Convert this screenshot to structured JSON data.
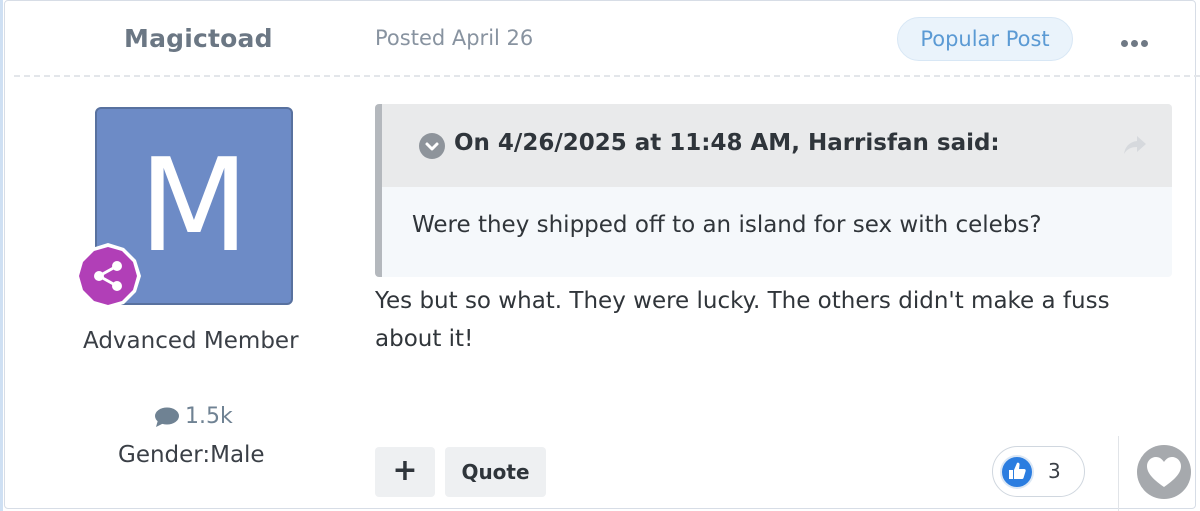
{
  "post": {
    "author": "Magictoad",
    "posted": "Posted April 26",
    "badge": "Popular Post",
    "avatar_letter": "M",
    "member_title": "Advanced Member",
    "post_count": "1.5k",
    "gender": "Gender:Male"
  },
  "quote": {
    "header": "On 4/26/2025 at 11:48 AM, Harrisfan said:",
    "text": "Were they shipped off to an island for sex with celebs?"
  },
  "body": {
    "text": "Yes but so what. They were lucky. The others didn't make a fuss about it!"
  },
  "actions": {
    "plus_label": "+",
    "quote_label": "Quote",
    "reaction_count": "3"
  },
  "colors": {
    "avatar_bg": "#6d8bc6",
    "badge_text": "#5b9ad4",
    "rank_badge": "#b13fb7",
    "like_blue": "#2b7de0"
  },
  "icons": [
    "more-icon",
    "rank-badge-icon",
    "comment-icon",
    "chevron-down-icon",
    "share-icon",
    "like-icon",
    "heart-icon"
  ]
}
